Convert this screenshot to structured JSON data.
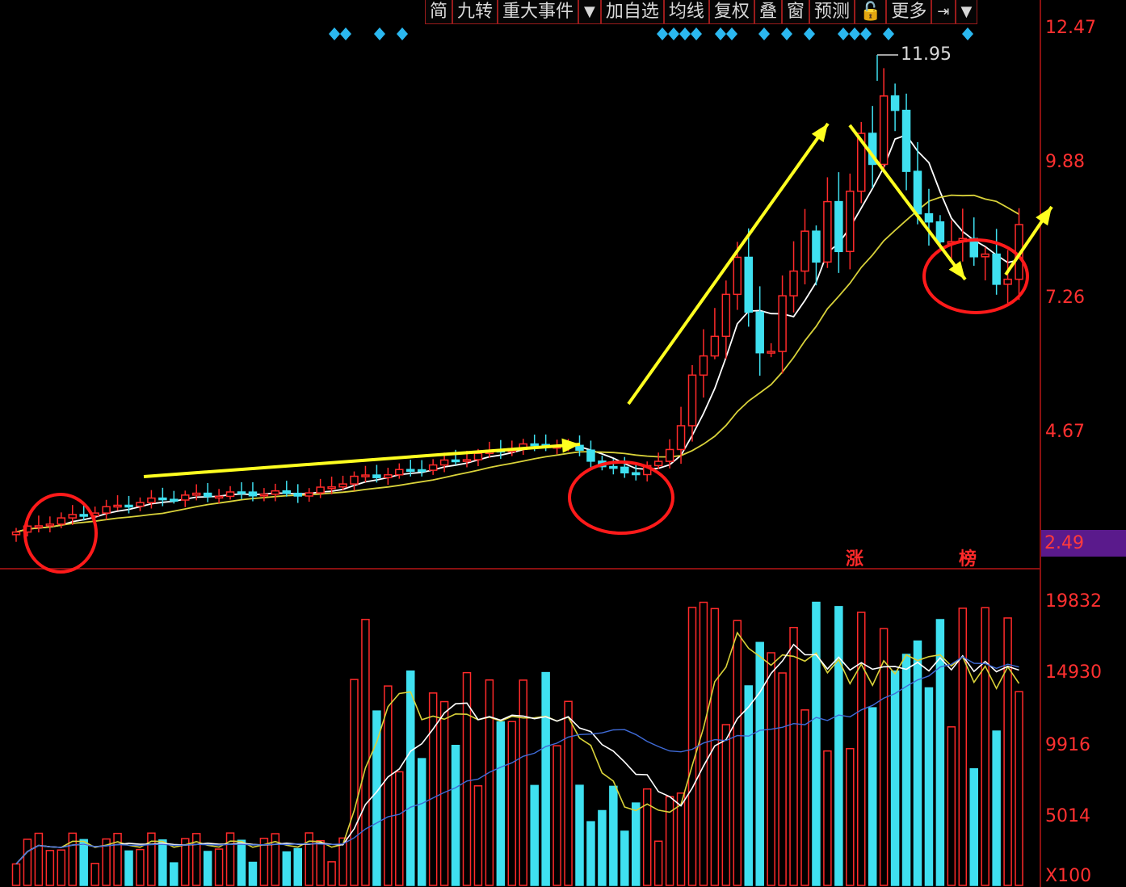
{
  "toolbar": {
    "items": [
      "简",
      "九转",
      "重大事件",
      "▼",
      "加自选",
      "均线",
      "复权",
      "叠",
      "窗",
      "预测",
      "🔓",
      "更多",
      "⇥",
      "▼"
    ]
  },
  "colors": {
    "up": "#ff2a2a",
    "down": "#3fe0f0",
    "ma_white": "#ffffff",
    "ma_yellow": "#d9d23a",
    "ma_blue": "#3f6bd8",
    "annotation_arrow": "#ffff20",
    "annotation_circle": "#ff1a1a",
    "grid": "#7a1010",
    "signal_diamond": "#2bb8f0"
  },
  "chart_data": {
    "type": "candlestick",
    "price_axis_labels": [
      "12.47",
      "9.88",
      "7.26",
      "4.67",
      "2.49"
    ],
    "price_ylim": [
      2.49,
      12.47
    ],
    "last_price_label": "2.49",
    "peak_label": "11.95",
    "volume_axis_labels": [
      "19832",
      "14930",
      "9916",
      "5014",
      "X100"
    ],
    "volume_ylim": [
      0,
      19832
    ],
    "markers": [
      "涨",
      "榜"
    ]
  }
}
